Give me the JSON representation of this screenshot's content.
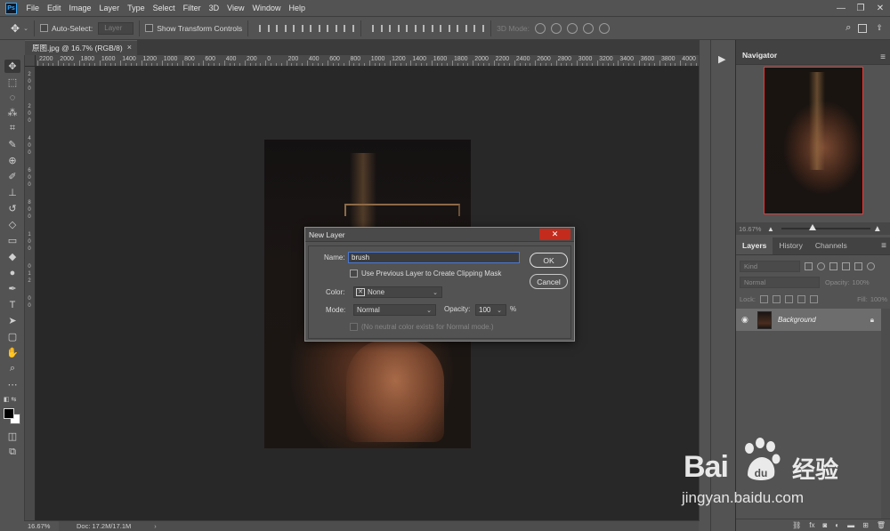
{
  "app": {
    "logo_text": "Ps"
  },
  "menu": [
    "File",
    "Edit",
    "Image",
    "Layer",
    "Type",
    "Select",
    "Filter",
    "3D",
    "View",
    "Window",
    "Help"
  ],
  "window_controls": {
    "minimize": "—",
    "restore": "❐",
    "close": "✕"
  },
  "options_bar": {
    "auto_select_label": "Auto-Select:",
    "auto_select_value": "Layer",
    "show_transform_label": "Show Transform Controls",
    "mode_3d_label": "3D Mode:"
  },
  "document_tab": {
    "title": "原图.jpg @ 16.7% (RGB/8)",
    "close": "×"
  },
  "ruler_h_labels": [
    "2200",
    "2000",
    "1800",
    "1600",
    "1400",
    "1200",
    "1000",
    "800",
    "600",
    "400",
    "200",
    "0",
    "200",
    "400",
    "600",
    "800",
    "1000",
    "1200",
    "1400",
    "1600",
    "1800",
    "2000",
    "2200",
    "2400",
    "2600",
    "2800",
    "3000",
    "3200",
    "3400",
    "3600",
    "3800",
    "4000"
  ],
  "ruler_v_labels": [
    "2",
    "0",
    "0",
    "2",
    "0",
    "0",
    "4",
    "0",
    "0",
    "6",
    "0",
    "0",
    "8",
    "0",
    "0",
    "1",
    "0",
    "0",
    "0",
    "1",
    "2",
    "0",
    "0"
  ],
  "status": {
    "zoom": "16.67%",
    "doc": "Doc: 17.2M/17.1M",
    "arrow": "›"
  },
  "navigator": {
    "title": "Navigator",
    "zoom": "16.67%",
    "slider_fraction": 0.35
  },
  "layers_panel": {
    "tabs": [
      "Layers",
      "History",
      "Channels"
    ],
    "kind_label": "Kind",
    "blend_mode": "Normal",
    "opacity_label": "Opacity:",
    "opacity_value": "100%",
    "lock_label": "Lock:",
    "fill_label": "Fill:",
    "fill_value": "100%",
    "layers": [
      {
        "name": "Background",
        "locked": true
      }
    ]
  },
  "dialog": {
    "title": "New Layer",
    "close": "✕",
    "name_label": "Name:",
    "name_value": "brush",
    "clip_label": "Use Previous Layer to Create Clipping Mask",
    "color_label": "Color:",
    "color_value": "None",
    "mode_label": "Mode:",
    "mode_value": "Normal",
    "opacity_label": "Opacity:",
    "opacity_value": "100",
    "opacity_unit": "%",
    "neutral_label": "(No neutral color exists for Normal mode.)",
    "ok_label": "OK",
    "cancel_label": "Cancel"
  },
  "watermark": {
    "brand": "Bai",
    "cn": "经验",
    "url": "jingyan.baidu.com"
  }
}
